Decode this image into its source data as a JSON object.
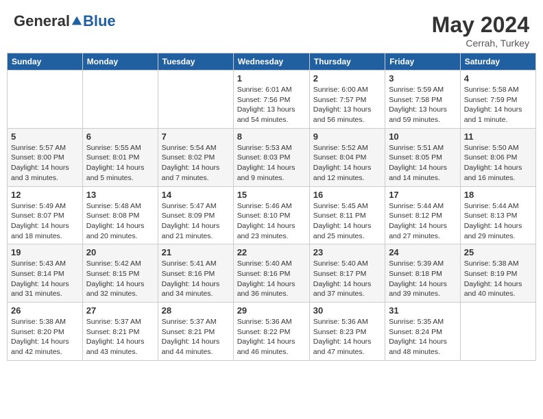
{
  "header": {
    "logo_general": "General",
    "logo_blue": "Blue",
    "month_year": "May 2024",
    "location": "Cerrah, Turkey"
  },
  "weekdays": [
    "Sunday",
    "Monday",
    "Tuesday",
    "Wednesday",
    "Thursday",
    "Friday",
    "Saturday"
  ],
  "weeks": [
    [
      {
        "day": "",
        "info": ""
      },
      {
        "day": "",
        "info": ""
      },
      {
        "day": "",
        "info": ""
      },
      {
        "day": "1",
        "info": "Sunrise: 6:01 AM\nSunset: 7:56 PM\nDaylight: 13 hours and 54 minutes."
      },
      {
        "day": "2",
        "info": "Sunrise: 6:00 AM\nSunset: 7:57 PM\nDaylight: 13 hours and 56 minutes."
      },
      {
        "day": "3",
        "info": "Sunrise: 5:59 AM\nSunset: 7:58 PM\nDaylight: 13 hours and 59 minutes."
      },
      {
        "day": "4",
        "info": "Sunrise: 5:58 AM\nSunset: 7:59 PM\nDaylight: 14 hours and 1 minute."
      }
    ],
    [
      {
        "day": "5",
        "info": "Sunrise: 5:57 AM\nSunset: 8:00 PM\nDaylight: 14 hours and 3 minutes."
      },
      {
        "day": "6",
        "info": "Sunrise: 5:55 AM\nSunset: 8:01 PM\nDaylight: 14 hours and 5 minutes."
      },
      {
        "day": "7",
        "info": "Sunrise: 5:54 AM\nSunset: 8:02 PM\nDaylight: 14 hours and 7 minutes."
      },
      {
        "day": "8",
        "info": "Sunrise: 5:53 AM\nSunset: 8:03 PM\nDaylight: 14 hours and 9 minutes."
      },
      {
        "day": "9",
        "info": "Sunrise: 5:52 AM\nSunset: 8:04 PM\nDaylight: 14 hours and 12 minutes."
      },
      {
        "day": "10",
        "info": "Sunrise: 5:51 AM\nSunset: 8:05 PM\nDaylight: 14 hours and 14 minutes."
      },
      {
        "day": "11",
        "info": "Sunrise: 5:50 AM\nSunset: 8:06 PM\nDaylight: 14 hours and 16 minutes."
      }
    ],
    [
      {
        "day": "12",
        "info": "Sunrise: 5:49 AM\nSunset: 8:07 PM\nDaylight: 14 hours and 18 minutes."
      },
      {
        "day": "13",
        "info": "Sunrise: 5:48 AM\nSunset: 8:08 PM\nDaylight: 14 hours and 20 minutes."
      },
      {
        "day": "14",
        "info": "Sunrise: 5:47 AM\nSunset: 8:09 PM\nDaylight: 14 hours and 21 minutes."
      },
      {
        "day": "15",
        "info": "Sunrise: 5:46 AM\nSunset: 8:10 PM\nDaylight: 14 hours and 23 minutes."
      },
      {
        "day": "16",
        "info": "Sunrise: 5:45 AM\nSunset: 8:11 PM\nDaylight: 14 hours and 25 minutes."
      },
      {
        "day": "17",
        "info": "Sunrise: 5:44 AM\nSunset: 8:12 PM\nDaylight: 14 hours and 27 minutes."
      },
      {
        "day": "18",
        "info": "Sunrise: 5:44 AM\nSunset: 8:13 PM\nDaylight: 14 hours and 29 minutes."
      }
    ],
    [
      {
        "day": "19",
        "info": "Sunrise: 5:43 AM\nSunset: 8:14 PM\nDaylight: 14 hours and 31 minutes."
      },
      {
        "day": "20",
        "info": "Sunrise: 5:42 AM\nSunset: 8:15 PM\nDaylight: 14 hours and 32 minutes."
      },
      {
        "day": "21",
        "info": "Sunrise: 5:41 AM\nSunset: 8:16 PM\nDaylight: 14 hours and 34 minutes."
      },
      {
        "day": "22",
        "info": "Sunrise: 5:40 AM\nSunset: 8:16 PM\nDaylight: 14 hours and 36 minutes."
      },
      {
        "day": "23",
        "info": "Sunrise: 5:40 AM\nSunset: 8:17 PM\nDaylight: 14 hours and 37 minutes."
      },
      {
        "day": "24",
        "info": "Sunrise: 5:39 AM\nSunset: 8:18 PM\nDaylight: 14 hours and 39 minutes."
      },
      {
        "day": "25",
        "info": "Sunrise: 5:38 AM\nSunset: 8:19 PM\nDaylight: 14 hours and 40 minutes."
      }
    ],
    [
      {
        "day": "26",
        "info": "Sunrise: 5:38 AM\nSunset: 8:20 PM\nDaylight: 14 hours and 42 minutes."
      },
      {
        "day": "27",
        "info": "Sunrise: 5:37 AM\nSunset: 8:21 PM\nDaylight: 14 hours and 43 minutes."
      },
      {
        "day": "28",
        "info": "Sunrise: 5:37 AM\nSunset: 8:21 PM\nDaylight: 14 hours and 44 minutes."
      },
      {
        "day": "29",
        "info": "Sunrise: 5:36 AM\nSunset: 8:22 PM\nDaylight: 14 hours and 46 minutes."
      },
      {
        "day": "30",
        "info": "Sunrise: 5:36 AM\nSunset: 8:23 PM\nDaylight: 14 hours and 47 minutes."
      },
      {
        "day": "31",
        "info": "Sunrise: 5:35 AM\nSunset: 8:24 PM\nDaylight: 14 hours and 48 minutes."
      },
      {
        "day": "",
        "info": ""
      }
    ]
  ]
}
